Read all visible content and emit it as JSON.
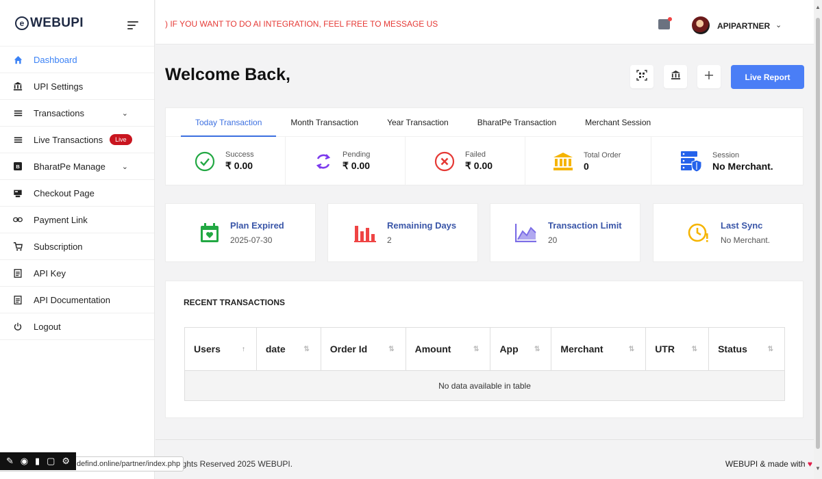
{
  "brand": {
    "name": "WEBUPI",
    "mark": "e"
  },
  "sidebar": {
    "items": [
      {
        "label": "Dashboard",
        "icon": "home-icon",
        "active": true
      },
      {
        "label": "UPI Settings",
        "icon": "bank-icon"
      },
      {
        "label": "Transactions",
        "icon": "list-icon",
        "chevron": true
      },
      {
        "label": "Live Transactions",
        "icon": "list-icon",
        "badge": "Live"
      },
      {
        "label": "BharatPe Manage",
        "icon": "bharatpe-icon",
        "chevron": true
      },
      {
        "label": "Checkout Page",
        "icon": "checkout-icon"
      },
      {
        "label": "Payment Link",
        "icon": "link-icon"
      },
      {
        "label": "Subscription",
        "icon": "cart-icon"
      },
      {
        "label": "API Key",
        "icon": "document-icon"
      },
      {
        "label": "API Documentation",
        "icon": "document-icon"
      },
      {
        "label": "Logout",
        "icon": "power-icon"
      }
    ]
  },
  "topbar": {
    "marquee": ") IF YOU WANT TO DO AI INTEGRATION, FEEL FREE TO MESSAGE US",
    "username": "APIPARTNER"
  },
  "main": {
    "welcome": "Welcome Back,",
    "live_report": "Live Report",
    "tabs": [
      "Today Transaction",
      "Month Transaction",
      "Year Transaction",
      "BharatPe Transaction",
      "Merchant Session"
    ],
    "stats": [
      {
        "label": "Success",
        "value": "₹ 0.00"
      },
      {
        "label": "Pending",
        "value": "₹ 0.00"
      },
      {
        "label": "Failed",
        "value": "₹ 0.00"
      },
      {
        "label": "Total Order",
        "value": "0"
      },
      {
        "label": "Session",
        "value": "No Merchant."
      }
    ],
    "info_cards": [
      {
        "title": "Plan Expired",
        "value": "2025-07-30"
      },
      {
        "title": "Remaining Days",
        "value": "2"
      },
      {
        "title": "Transaction Limit",
        "value": "20"
      },
      {
        "title": "Last Sync",
        "value": "No Merchant."
      }
    ],
    "recent": {
      "title": "RECENT TRANSACTIONS",
      "columns": [
        "Users",
        "date",
        "Order Id",
        "Amount",
        "App",
        "Merchant",
        "UTR",
        "Status"
      ],
      "empty": "No data available in table"
    }
  },
  "footer": {
    "left": "ights Reserved 2025 WEBUPI.",
    "right": "WEBUPI & made with"
  },
  "statusbar": {
    "url": "defind.online/partner/index.php"
  },
  "colors": {
    "accent": "#4a7ef6",
    "brand": "#1f2a44",
    "danger": "#e53935",
    "live_badge": "#c9151f"
  }
}
